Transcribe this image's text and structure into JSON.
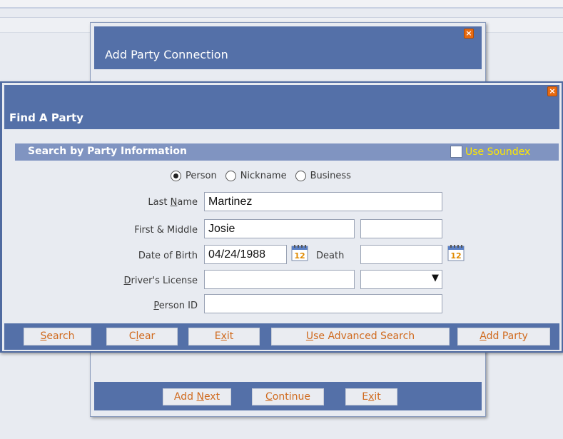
{
  "back_dialog": {
    "title": "Add Party Connection",
    "buttons": {
      "add_next": "Add Next",
      "continue": "Continue",
      "exit": "Exit"
    }
  },
  "front_dialog": {
    "title": "Find A Party",
    "section_title": "Search by Party Information",
    "use_soundex_label": "Use Soundex",
    "party_types": [
      "Person",
      "Nickname",
      "Business"
    ],
    "selected_party_type": "Person",
    "fields": {
      "last_name": {
        "label": "Last Name",
        "value": "Martinez"
      },
      "first_middle": {
        "label": "First & Middle",
        "first_value": "Josie",
        "middle_value": ""
      },
      "date_of_birth": {
        "label": "Date of Birth",
        "value": "04/24/1988"
      },
      "death": {
        "label": "Death",
        "value": ""
      },
      "drivers_license": {
        "label": "Driver's License",
        "value": "",
        "state_value": ""
      },
      "person_id": {
        "label": "Person ID",
        "value": ""
      }
    },
    "buttons": {
      "search": "Search",
      "clear": "Clear",
      "exit": "Exit",
      "advanced_search": "Use Advanced Search",
      "add_party": "Add Party"
    },
    "calendar_icon_text": "12"
  },
  "colors": {
    "titlebar": "#5470a8",
    "section_header": "#8094c1",
    "button_text": "#d06a1e",
    "soundex_label": "#ffe800",
    "close_button": "#e86a10"
  }
}
